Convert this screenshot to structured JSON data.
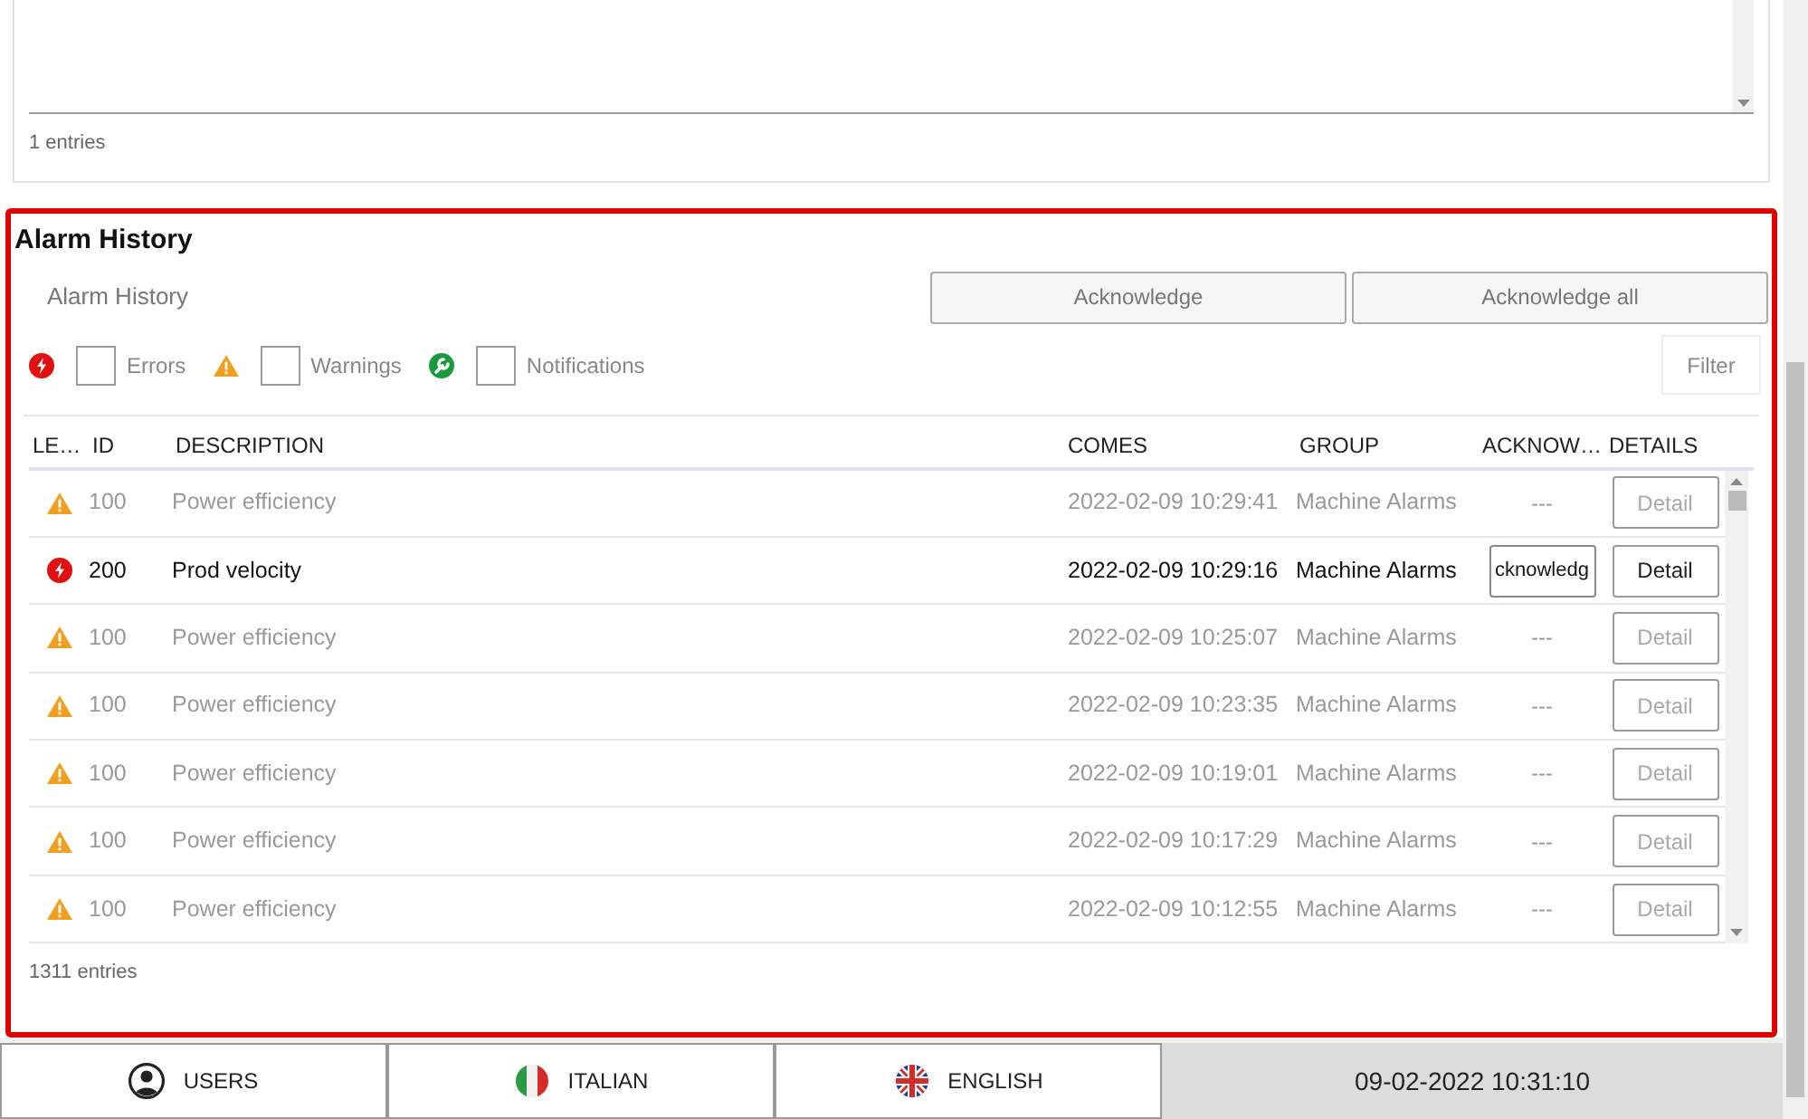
{
  "top_panel": {
    "entries": "1 entries"
  },
  "alarm_history": {
    "title": "Alarm History",
    "subtitle": "Alarm History",
    "buttons": [
      "Acknowledge",
      "Acknowledge all"
    ],
    "filters": [
      {
        "kind": "error",
        "label": "Errors",
        "checked": false
      },
      {
        "kind": "warning",
        "label": "Warnings",
        "checked": false
      },
      {
        "kind": "notification",
        "label": "Notifications",
        "checked": false
      }
    ],
    "filter_button": "Filter",
    "columns": [
      "LE…",
      "ID",
      "DESCRIPTION",
      "COMES",
      "GROUP",
      "ACKNOW…",
      "DETAILS"
    ],
    "rows": [
      {
        "kind": "warning",
        "id": "100",
        "description": "Power efficiency",
        "comes": "2022-02-09 10:29:41",
        "group": "Machine Alarms",
        "active": false,
        "acknowledge": "---",
        "detail": "Detail"
      },
      {
        "kind": "error",
        "id": "200",
        "description": "Prod velocity",
        "comes": "2022-02-09 10:29:16",
        "group": "Machine Alarms",
        "active": true,
        "acknowledge": "cknowledg",
        "detail": "Detail"
      },
      {
        "kind": "warning",
        "id": "100",
        "description": "Power efficiency",
        "comes": "2022-02-09 10:25:07",
        "group": "Machine Alarms",
        "active": false,
        "acknowledge": "---",
        "detail": "Detail"
      },
      {
        "kind": "warning",
        "id": "100",
        "description": "Power efficiency",
        "comes": "2022-02-09 10:23:35",
        "group": "Machine Alarms",
        "active": false,
        "acknowledge": "---",
        "detail": "Detail"
      },
      {
        "kind": "warning",
        "id": "100",
        "description": "Power efficiency",
        "comes": "2022-02-09 10:19:01",
        "group": "Machine Alarms",
        "active": false,
        "acknowledge": "---",
        "detail": "Detail"
      },
      {
        "kind": "warning",
        "id": "100",
        "description": "Power efficiency",
        "comes": "2022-02-09 10:17:29",
        "group": "Machine Alarms",
        "active": false,
        "acknowledge": "---",
        "detail": "Detail"
      },
      {
        "kind": "warning",
        "id": "100",
        "description": "Power efficiency",
        "comes": "2022-02-09 10:12:55",
        "group": "Machine Alarms",
        "active": false,
        "acknowledge": "---",
        "detail": "Detail"
      }
    ],
    "entries": "1311 entries"
  },
  "bottom_bar": {
    "buttons": [
      {
        "kind": "user",
        "label": "USERS"
      },
      {
        "kind": "italy",
        "label": "ITALIAN"
      },
      {
        "kind": "uk",
        "label": "ENGLISH"
      }
    ],
    "datetime": "09-02-2022 10:31:10"
  }
}
